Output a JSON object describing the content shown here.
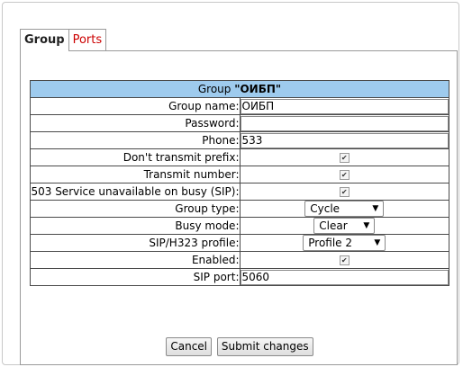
{
  "tabs": {
    "group": "Group",
    "ports": "Ports"
  },
  "form": {
    "header_prefix": "Group ",
    "header_name": "\"ОИБП\"",
    "rows": {
      "group_name": {
        "label": "Group name:",
        "value": "ОИБП"
      },
      "password": {
        "label": "Password:",
        "value": ""
      },
      "phone": {
        "label": "Phone:",
        "value": "533"
      },
      "dont_transmit_prefix": {
        "label": "Don't transmit prefix:",
        "checked": true
      },
      "transmit_number": {
        "label": "Transmit number:",
        "checked": true
      },
      "service_unavailable": {
        "label": "503 Service unavailable on busy (SIP):",
        "checked": true
      },
      "group_type": {
        "label": "Group type:",
        "value": "Cycle"
      },
      "busy_mode": {
        "label": "Busy mode:",
        "value": "Clear"
      },
      "sip_profile": {
        "label": "SIP/H323 profile:",
        "value": "Profile 2"
      },
      "enabled": {
        "label": "Enabled:",
        "checked": true
      },
      "sip_port": {
        "label": "SIP port:",
        "value": "5060"
      }
    }
  },
  "buttons": {
    "cancel": "Cancel",
    "submit": "Submit changes"
  },
  "icons": {
    "checkbox": "checkmark-icon",
    "dropdown": "dropdown-arrow-icon"
  },
  "colors": {
    "header_bg": "#9ecbee",
    "inactive_tab": "#cc0000"
  }
}
